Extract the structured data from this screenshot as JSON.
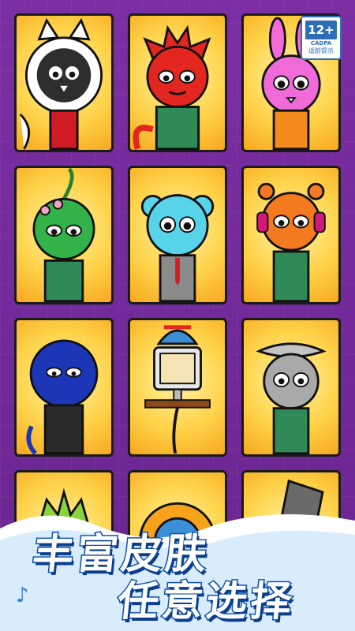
{
  "rating": {
    "age": "12+",
    "org": "CADPA",
    "tip": "适龄提示"
  },
  "banner": {
    "line1": "丰富皮肤",
    "line2": "任意选择",
    "note_icon": "music-note-icon"
  },
  "characters": [
    {
      "name": "white-cat-character",
      "color": "#444444"
    },
    {
      "name": "red-spiky-character",
      "color": "#e3261f"
    },
    {
      "name": "pink-bunny-character",
      "color": "#f06bd8"
    },
    {
      "name": "green-plant-character",
      "color": "#33b24a"
    },
    {
      "name": "cyan-bear-character",
      "color": "#57d3ea"
    },
    {
      "name": "orange-headphones-character",
      "color": "#f37a1e"
    },
    {
      "name": "blue-hood-character",
      "color": "#1b37b8"
    },
    {
      "name": "computer-propeller-character",
      "color": "#3b8fd6"
    },
    {
      "name": "grey-satellite-character",
      "color": "#a9a9a9"
    },
    {
      "name": "green-spiky-character",
      "color": "#8ad33a"
    },
    {
      "name": "sun-character",
      "color": "#f7a21b"
    },
    {
      "name": "bucket-hat-character",
      "color": "#4a4a4a"
    }
  ]
}
